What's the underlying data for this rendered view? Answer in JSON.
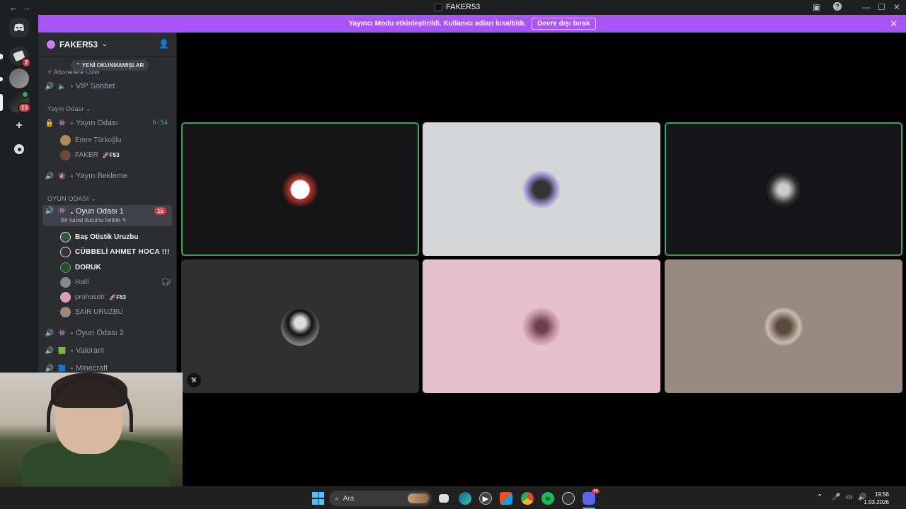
{
  "titlebar": {
    "title": "FAKER53",
    "back": "←",
    "forward": "→"
  },
  "rail": {
    "badges": [
      "2",
      "23"
    ]
  },
  "notice": {
    "text": "Yayıncı Modu etkinleştirildi. Kullanıcı adları kısaltıldı.",
    "button": "Devre dışı bırak"
  },
  "server": {
    "name": "FAKER53"
  },
  "sidebar": {
    "unread_pill": "YENİ OKUNMAMIŞLAR",
    "partial_top": "Abonelere Özel",
    "vip": "VIP Sohbet",
    "cat1": "Yayın Odası",
    "stream_room": "Yayın Odası",
    "stream_time": "6:54",
    "stream_users": [
      {
        "name": "Emre Türkoğlu"
      },
      {
        "name": "FAKER",
        "tag": "F53"
      }
    ],
    "waiting": "Yayın Bekleme",
    "cat2": "OYUN ODASI",
    "game1": "Oyun Odası 1",
    "game1_count": "15",
    "game1_status": "Bir kanal durumu belirle",
    "game1_users": [
      {
        "name": "Baş Otistik Uruzbu"
      },
      {
        "name": "CÜBBELİ AHMET HOCA !!!"
      },
      {
        "name": "DORUK"
      },
      {
        "name": "Halil"
      },
      {
        "name": "prohusotr",
        "tag": "F53"
      },
      {
        "name": "ŞAİR URUZBU"
      }
    ],
    "game2": "Oyun Odası 2",
    "valorant": "Valorant",
    "minecraft": "Minecraft"
  },
  "taskbar": {
    "search_placeholder": "Ara",
    "time": "19:56",
    "date": "1.03.2026",
    "discord_badge": "69"
  },
  "colors": {
    "accent": "#a855f7",
    "speaking": "#3ba55d",
    "badge": "#da373c"
  }
}
